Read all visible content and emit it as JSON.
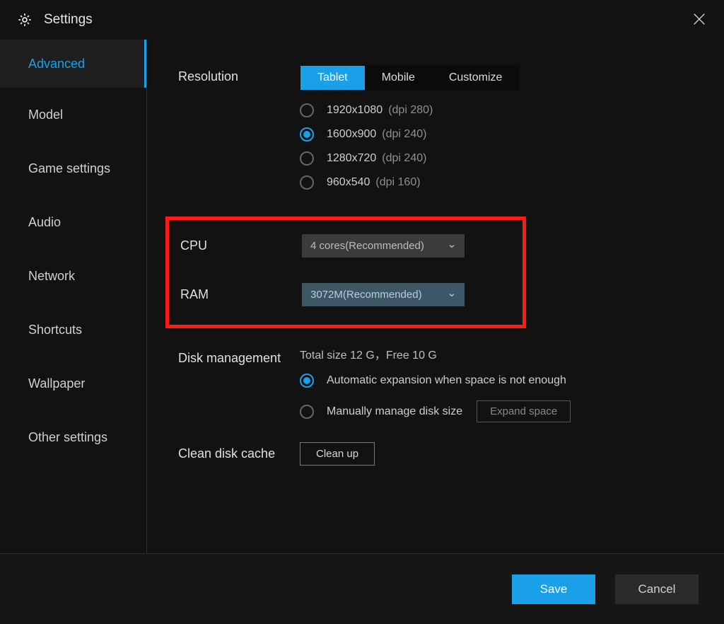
{
  "title": "Settings",
  "sidebar": {
    "items": [
      {
        "label": "Advanced"
      },
      {
        "label": "Model"
      },
      {
        "label": "Game settings"
      },
      {
        "label": "Audio"
      },
      {
        "label": "Network"
      },
      {
        "label": "Shortcuts"
      },
      {
        "label": "Wallpaper"
      },
      {
        "label": "Other settings"
      }
    ]
  },
  "resolution": {
    "label": "Resolution",
    "tabs": {
      "tablet": "Tablet",
      "mobile": "Mobile",
      "customize": "Customize"
    },
    "options": [
      {
        "res": "1920x1080",
        "dpi": "(dpi 280)"
      },
      {
        "res": "1600x900",
        "dpi": "(dpi 240)"
      },
      {
        "res": "1280x720",
        "dpi": "(dpi 240)"
      },
      {
        "res": "960x540",
        "dpi": "(dpi 160)"
      }
    ]
  },
  "cpu": {
    "label": "CPU",
    "value": "4 cores(Recommended)"
  },
  "ram": {
    "label": "RAM",
    "value": "3072M(Recommended)"
  },
  "disk": {
    "label": "Disk management",
    "stat": "Total size 12 G，Free 10 G",
    "auto": "Automatic expansion when space is not enough",
    "manual": "Manually manage disk size",
    "expand": "Expand space"
  },
  "cache": {
    "label": "Clean disk cache",
    "button": "Clean up"
  },
  "footer": {
    "save": "Save",
    "cancel": "Cancel"
  }
}
